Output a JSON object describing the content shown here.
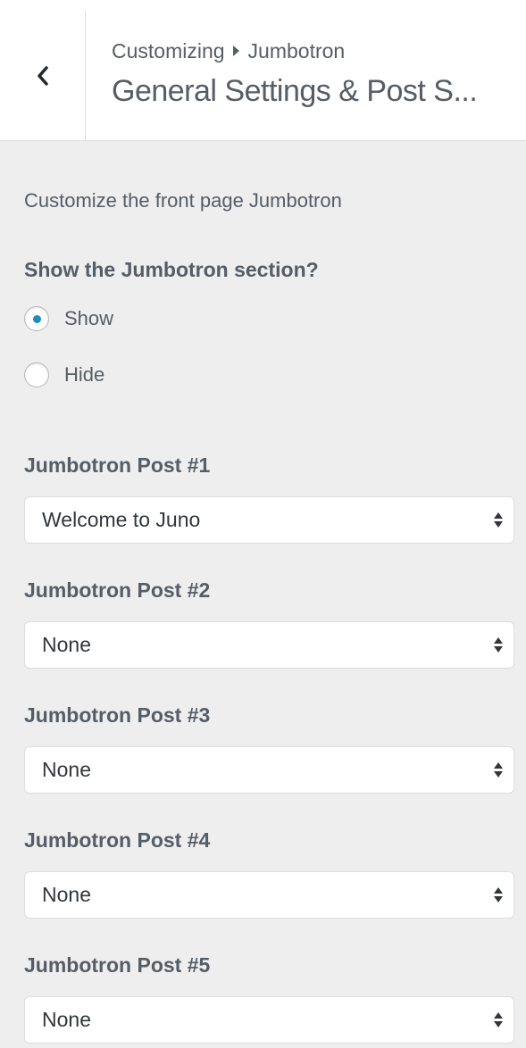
{
  "header": {
    "breadcrumb_root": "Customizing",
    "breadcrumb_current": "Jumbotron",
    "section_title": "General Settings & Post S..."
  },
  "content": {
    "description": "Customize the front page Jumbotron",
    "visibility": {
      "label": "Show the Jumbotron section?",
      "selected": "Show",
      "options": [
        {
          "label": "Show",
          "checked": true
        },
        {
          "label": "Hide",
          "checked": false
        }
      ]
    },
    "posts": [
      {
        "label": "Jumbotron Post #1",
        "value": "Welcome to Juno"
      },
      {
        "label": "Jumbotron Post #2",
        "value": "None"
      },
      {
        "label": "Jumbotron Post #3",
        "value": "None"
      },
      {
        "label": "Jumbotron Post #4",
        "value": "None"
      },
      {
        "label": "Jumbotron Post #5",
        "value": "None"
      }
    ]
  },
  "colors": {
    "accent": "#1e8cbe",
    "panel_bg": "#eeeeee",
    "header_bg": "#ffffff",
    "text": "#555d66"
  }
}
